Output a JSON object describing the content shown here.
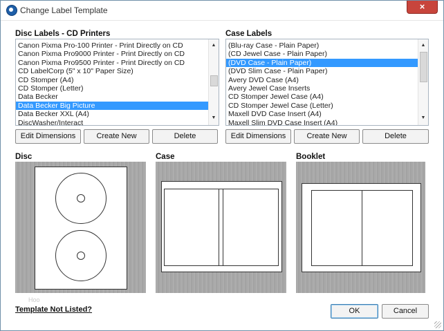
{
  "window": {
    "title": "Change Label Template",
    "close_glyph": "×"
  },
  "disc_section": {
    "label": "Disc Labels - CD Printers",
    "items": [
      {
        "text": "Canon Pixma Pro-100 Printer - Print Directly on CD",
        "selected": false
      },
      {
        "text": "Canon Pixma Pro9000 Printer - Print Directly on CD",
        "selected": false
      },
      {
        "text": "Canon Pixma Pro9500 Printer - Print Directly on CD",
        "selected": false
      },
      {
        "text": "CD LabelCorp (5\" x 10\" Paper Size)",
        "selected": false
      },
      {
        "text": "CD Stomper (A4)",
        "selected": false
      },
      {
        "text": "CD Stomper (Letter)",
        "selected": false
      },
      {
        "text": "Data Becker",
        "selected": false
      },
      {
        "text": "Data Becker Big Picture",
        "selected": true
      },
      {
        "text": "Data Becker XXL (A4)",
        "selected": false
      },
      {
        "text": "DiscWasher/Interact",
        "selected": false
      }
    ],
    "buttons": {
      "edit": "Edit Dimensions",
      "create": "Create New",
      "delete": "Delete"
    }
  },
  "case_section": {
    "label": "Case Labels",
    "items": [
      {
        "text": "(Blu-ray Case - Plain Paper)",
        "selected": false
      },
      {
        "text": "(CD Jewel Case - Plain Paper)",
        "selected": false
      },
      {
        "text": "(DVD Case - Plain Paper)",
        "selected": true
      },
      {
        "text": "(DVD Slim Case - Plain Paper)",
        "selected": false
      },
      {
        "text": "Avery DVD Case (A4)",
        "selected": false
      },
      {
        "text": "Avery Jewel Case Inserts",
        "selected": false
      },
      {
        "text": "CD Stomper Jewel Case (A4)",
        "selected": false
      },
      {
        "text": "CD Stomper Jewel Case (Letter)",
        "selected": false
      },
      {
        "text": "Maxell DVD Case Insert (A4)",
        "selected": false
      },
      {
        "text": "Maxell Slim DVD Case Insert (A4)",
        "selected": false
      }
    ],
    "buttons": {
      "edit": "Edit Dimensions",
      "create": "Create New",
      "delete": "Delete"
    }
  },
  "previews": {
    "disc": "Disc",
    "case": "Case",
    "booklet": "Booklet",
    "faint_text": "Ноо"
  },
  "footer": {
    "link": "Template Not Listed?",
    "ok": "OK",
    "cancel": "Cancel"
  },
  "colors": {
    "selection": "#3399ff",
    "preview_bg": "#a7a7a7",
    "close": "#c8453c"
  },
  "icons": {
    "app": "app-disc-icon",
    "scroll_up": "▲",
    "scroll_down": "▼"
  }
}
